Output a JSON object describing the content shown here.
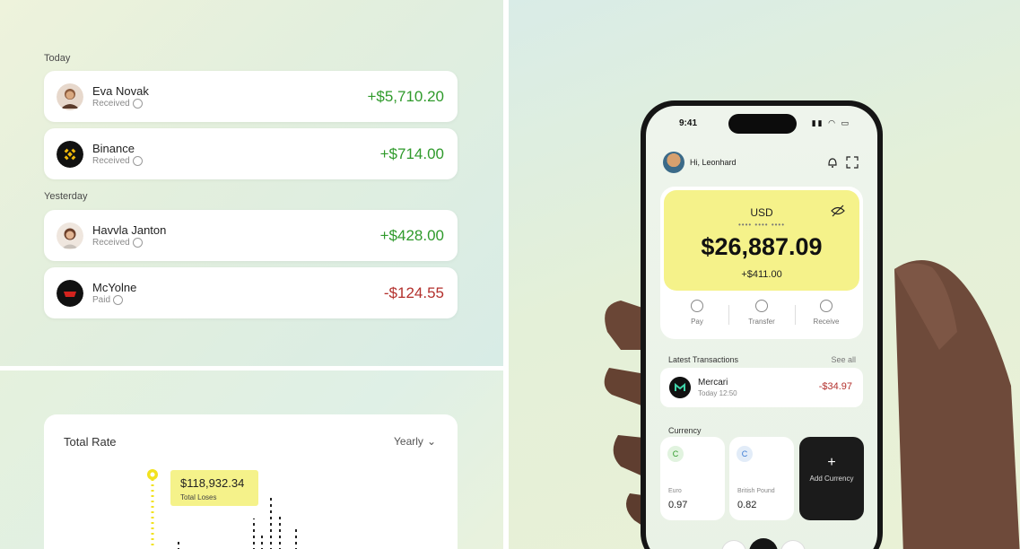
{
  "feed": {
    "today_label": "Today",
    "yesterday_label": "Yesterday",
    "transactions": [
      {
        "name": "Eva Novak",
        "status": "Received",
        "amount": "+$5,710.20",
        "type": "positive"
      },
      {
        "name": "Binance",
        "status": "Received",
        "amount": "+$714.00",
        "type": "positive"
      },
      {
        "name": "Havvla Janton",
        "status": "Received",
        "amount": "+$428.00",
        "type": "positive"
      },
      {
        "name": "McYolne",
        "status": "Paid",
        "amount": "-$124.55",
        "type": "negative"
      }
    ],
    "colors": {
      "positive": "#2f9a2b",
      "negative": "#b3302c"
    }
  },
  "chart": {
    "title": "Total Rate",
    "range_label": "Yearly",
    "range_icon": "chevron-down-icon",
    "tooltip_value": "$118,932.34",
    "tooltip_label": "Total Loses",
    "accent": "#f5f28a",
    "marker": "#f2e21f"
  },
  "phone": {
    "status_time": "9:41",
    "status_icons": "signal-wifi-battery",
    "greeting": "Hi, Leonhard",
    "balance": {
      "currency": "USD",
      "masked": "•••• •••• ••••",
      "amount": "$26,887.09",
      "change": "+$411.00"
    },
    "actions": [
      {
        "label": "Pay",
        "icon": "arrow-up-icon"
      },
      {
        "label": "Transfer",
        "icon": "swap-icon"
      },
      {
        "label": "Receive",
        "icon": "arrow-down-icon"
      }
    ],
    "recent": {
      "title": "Latest Transactions",
      "see_all": "See all",
      "name": "Mercari",
      "sub": "Today 12:50",
      "amount": "-$34.97"
    },
    "currency": {
      "title": "Currency",
      "cards": [
        {
          "sub": "Euro",
          "value": "0.97",
          "icon_color": "#2f9a2b",
          "icon": "C"
        },
        {
          "sub": "British Pound",
          "value": "0.82",
          "icon_color": "#3b7bd4",
          "icon": "C"
        }
      ],
      "add_label": "Add Currency"
    },
    "card_accent": "#f5f28a"
  }
}
